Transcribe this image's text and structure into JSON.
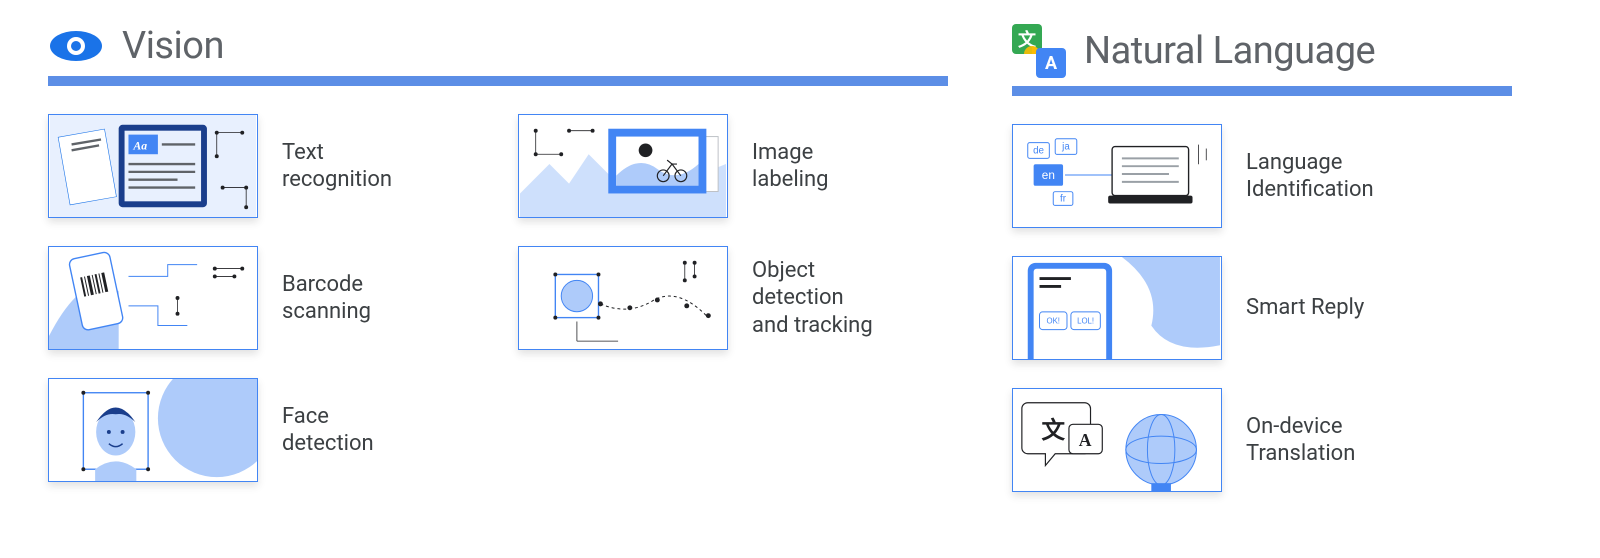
{
  "sections": {
    "vision": {
      "title": "Vision",
      "items": [
        {
          "label": "Text\nrecognition"
        },
        {
          "label": "Image\nlabeling"
        },
        {
          "label": "Barcode\nscanning"
        },
        {
          "label": "Object\ndetection\nand tracking"
        },
        {
          "label": "Face\ndetection"
        }
      ]
    },
    "nl": {
      "title": "Natural Language",
      "items": [
        {
          "label": "Language\nIdentification"
        },
        {
          "label": "Smart Reply"
        },
        {
          "label": "On-device\nTranslation"
        }
      ]
    }
  },
  "illustration_text": {
    "aa": "Aa",
    "li_de": "de",
    "li_ja": "ja",
    "li_en": "en",
    "li_fr": "fr",
    "sr_ok": "OK!",
    "sr_lol": "LOL!",
    "tl_cjk": "文",
    "tl_a": "A",
    "translate_icon_cjk": "文",
    "translate_icon_a": "A"
  }
}
